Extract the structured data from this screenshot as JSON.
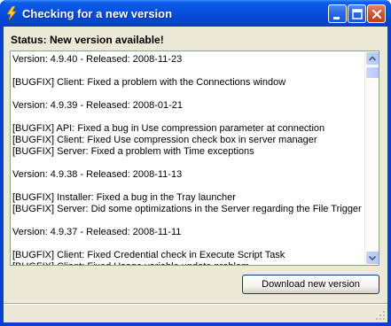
{
  "window": {
    "title": "Checking for a new version",
    "controls": [
      "minimize-icon",
      "maximize-icon",
      "close-icon"
    ]
  },
  "status_label": "Status: New version available!",
  "log": {
    "lines": [
      "Version:  4.9.40 - Released: 2008-11-23",
      "",
      "[BUGFIX] Client: Fixed a problem with the Connections window",
      "",
      "Version:  4.9.39 - Released: 2008-01-21",
      "",
      "[BUGFIX] API: Fixed a bug in Use compression parameter at connection",
      "[BUGFIX] Client: Fixed Use compression check box in server manager",
      "[BUGFIX] Server: Fixed a problem with Time exceptions",
      "",
      "Version:  4.9.38 - Released: 2008-11-13",
      "",
      "[BUGFIX] Installer: Fixed a bug in the Tray launcher",
      "[BUGFIX] Server: Did some optimizations in the Server regarding the File Trigger",
      "",
      "Version:  4.9.37 - Released: 2008-11-11",
      "",
      "[BUGFIX] Client: Fixed Credential check in Execute Script Task",
      "[BUGFIX] Client: Fixed Usage variable update problem"
    ]
  },
  "download_button": "Download new version",
  "colors": {
    "titlebar": "#0550dd",
    "client_bg": "#ece9d8",
    "log_border": "#7f9db9"
  }
}
